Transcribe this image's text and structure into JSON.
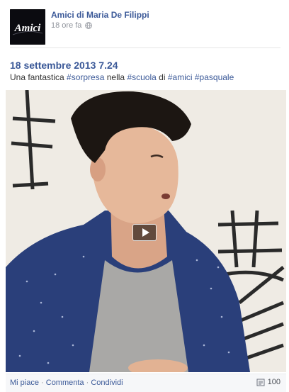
{
  "header": {
    "page_name": "Amici di Maria De Filippi",
    "timestamp": "18 ore fa",
    "avatar_logo_text": "Amici",
    "privacy_icon": "globe-icon"
  },
  "post": {
    "date": "18 settembre 2013 7.24",
    "text_parts": {
      "p1": "Una fantastica ",
      "tag1": "#sorpresa",
      "p2": " nella ",
      "tag2": "#scuola",
      "p3": " di ",
      "tag3": "#amici",
      "p4": " ",
      "tag4": "#pasquale"
    }
  },
  "video": {
    "play_icon": "play-icon"
  },
  "actions": {
    "like": "Mi piace",
    "sep1": " · ",
    "comment": "Commenta",
    "sep2": " · ",
    "share": "Condividi"
  },
  "share_count": {
    "icon": "share-icon",
    "value": "100"
  },
  "colors": {
    "link": "#3b5998",
    "meta": "#90949c",
    "text": "#333333",
    "action_bar_bg": "#f6f7f9"
  }
}
